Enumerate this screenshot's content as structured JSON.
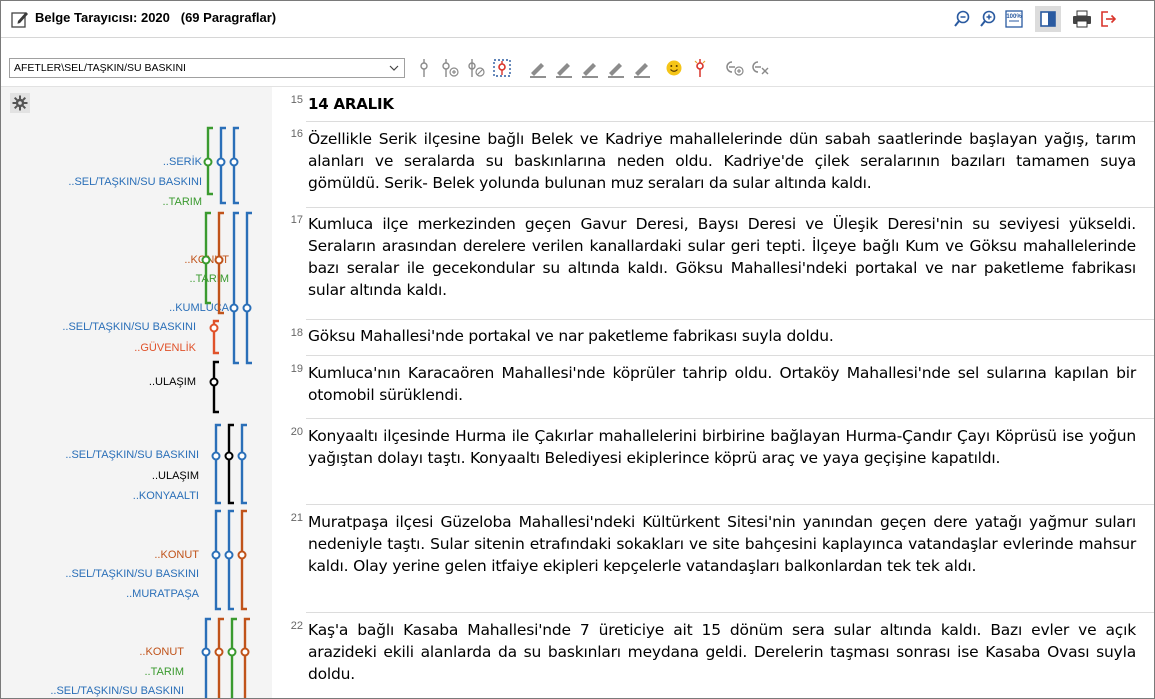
{
  "title": "Belge Tarayıcısı: 2020",
  "subtitle": "(69 Paragraflar)",
  "toolbar": {
    "code_select_value": "AFETLER\\SEL/TAŞKIN/SU BASKINI",
    "tools": [
      "pin-icon",
      "add-pin-icon",
      "pins-icon",
      "selection-icon",
      "highlighter-icon",
      "highlighter-icon",
      "highlighter-icon",
      "highlighter-icon",
      "highlighter-icon",
      "emoji-icon",
      "symbol-icon",
      "link-add-icon",
      "link-remove-icon"
    ]
  },
  "title_tools": {
    "zoom_out": "zoom-out-icon",
    "zoom_in": "zoom-in-icon",
    "zoom_100": "100%",
    "layout": "panel-icon",
    "print": "print-icon",
    "exit": "exit-icon"
  },
  "colors": {
    "blue": "#2a6fb8",
    "green": "#3a9a2f",
    "orange": "#c0531a",
    "red": "#e0522a",
    "black": "#000000"
  },
  "paragraphs": [
    {
      "num": "15",
      "text": "14 ARALIK",
      "bold": true
    },
    {
      "num": "16",
      "text": "Özellikle Serik ilçesine bağlı Belek ve Kadriye mahallelerinde dün sabah saatlerinde başlayan yağış, tarım alanları ve seralarda su baskınlarına neden oldu. Kadriye'de çilek seralarının bazıları tamamen suya gömüldü. Serik- Belek yolunda bulunan muz seraları da sular altında kaldı."
    },
    {
      "num": "17",
      "text": "Kumluca ilçe merkezinden geçen Gavur Deresi, Baysı Deresi ve Üleşik Deresi'nin su seviyesi yükseldi. Seraların arasından derelere verilen kanallardaki sular geri tepti. İlçeye bağlı Kum ve Göksu mahallelerinde bazı seralar ile gecekondular su altında kaldı. Göksu Mahallesi'ndeki portakal ve nar paketleme fabrikası sular altında kaldı."
    },
    {
      "num": "18",
      "text": "Göksu Mahallesi'nde portakal ve nar paketleme fabrikası suyla doldu."
    },
    {
      "num": "19",
      "text": "Kumluca'nın Karacaören Mahallesi'nde köprüler tahrip oldu. Ortaköy Mahallesi'nde sel sularına kapılan bir otomobil sürüklendi."
    },
    {
      "num": "20",
      "text": "Konyaaltı ilçesinde Hurma ile Çakırlar mahallelerini birbirine bağlayan Hurma-Çandır Çayı Köprüsü ise yoğun yağıştan dolayı taştı. Konyaaltı Belediyesi ekiplerince köprü araç ve yaya geçişine kapatıldı."
    },
    {
      "num": "21",
      "text": "Muratpaşa ilçesi Güzeloba Mahallesi'ndeki Kültürkent Sitesi'nin yanından geçen dere yatağı yağmur suları nedeniyle taştı. Sular sitenin etrafındaki sokakları ve site bahçesini kaplayınca vatandaşlar evlerinde mahsur kaldı. Olay yerine gelen itfaiye ekipleri kepçelerle vatandaşları balkonlardan tek tek aldı."
    },
    {
      "num": "22",
      "text": "Kaş'a bağlı Kasaba Mahallesi'nde 7 üreticiye ait 15 dönüm sera sular altında kaldı. Bazı evler ve açık arazideki ekili alanlarda da su baskınları meydana geldi. Derelerin taşması sonrası ise Kasaba Ovası suyla doldu."
    }
  ],
  "codes": [
    {
      "label": "..SERİK",
      "color": "blue"
    },
    {
      "label": "..SEL/TAŞKIN/SU BASKINI",
      "color": "blue"
    },
    {
      "label": "..TARIM",
      "color": "green"
    },
    {
      "label": "..KONUT",
      "color": "orange"
    },
    {
      "label": "..TARIM",
      "color": "green"
    },
    {
      "label": "..KUMLUCA",
      "color": "blue"
    },
    {
      "label": "..SEL/TAŞKIN/SU BASKINI",
      "color": "blue"
    },
    {
      "label": "..GÜVENLİK",
      "color": "red"
    },
    {
      "label": "..ULAŞIM",
      "color": "black"
    },
    {
      "label": "..SEL/TAŞKIN/SU BASKINI",
      "color": "blue"
    },
    {
      "label": "..ULAŞIM",
      "color": "black"
    },
    {
      "label": "..KONYAALTI",
      "color": "blue"
    },
    {
      "label": "..KONUT",
      "color": "orange"
    },
    {
      "label": "..SEL/TAŞKIN/SU BASKINI",
      "color": "blue"
    },
    {
      "label": "..MURATPAŞA",
      "color": "blue"
    },
    {
      "label": "..KONUT",
      "color": "orange"
    },
    {
      "label": "..TARIM",
      "color": "green"
    },
    {
      "label": "..SEL/TAŞKIN/SU BASKINI",
      "color": "blue"
    }
  ]
}
